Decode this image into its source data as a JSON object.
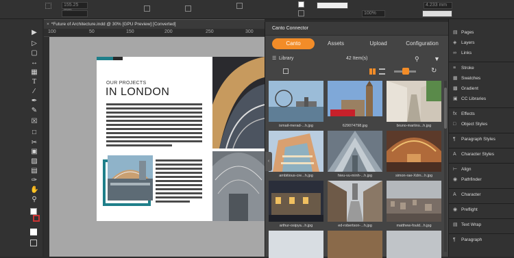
{
  "control_bar": {
    "x_value": "155.25 mm",
    "y_value": "",
    "zoom": "100%",
    "stroke_weight": "",
    "width_value": "4.233 mm"
  },
  "document": {
    "tab_title": "*Future of Architecture.indd @ 30% [GPU Preview] [Converted]",
    "ruler_ticks": [
      "100",
      "50",
      "100",
      "150",
      "200",
      "250",
      "300"
    ],
    "page_subtitle": "OUR PROJECTS",
    "page_title": "IN LONDON"
  },
  "canto": {
    "panel_title": "Canto Connector",
    "tabs": [
      "Canto",
      "Assets",
      "Upload",
      "Configuration"
    ],
    "active_tab": "Canto",
    "library_label": "Library",
    "item_count": "42 Item(s)",
    "items": [
      {
        "caption": "ismail-merad-...h.jpg"
      },
      {
        "caption": "629074798.jpg"
      },
      {
        "caption": "bruno-martins...h.jpg"
      },
      {
        "caption": "ambitious-cre...h.jpg"
      },
      {
        "caption": "hieu-vu-minh-...h.jpg"
      },
      {
        "caption": "simon-rae-Xdm...h.jpg"
      },
      {
        "caption": "arthur-osipya...h.jpg"
      },
      {
        "caption": "ed-robertson-...h.jpg"
      },
      {
        "caption": "matthew-fould...h.jpg"
      }
    ]
  },
  "side_panels": {
    "groups": [
      [
        "Pages",
        "Layers",
        "Links"
      ],
      [
        "Stroke",
        "Swatches",
        "Gradient",
        "CC Libraries"
      ],
      [
        "Effects",
        "Object Styles"
      ],
      [
        "Paragraph Styles"
      ],
      [
        "Character Styles"
      ],
      [
        "Align",
        "Pathfinder"
      ],
      [
        "Character"
      ],
      [
        "Preflight"
      ],
      [
        "Text Wrap"
      ],
      [
        "Paragraph"
      ]
    ]
  },
  "colors": {
    "accent_orange": "#f28c28",
    "brand_teal": "#1f7f8a"
  }
}
